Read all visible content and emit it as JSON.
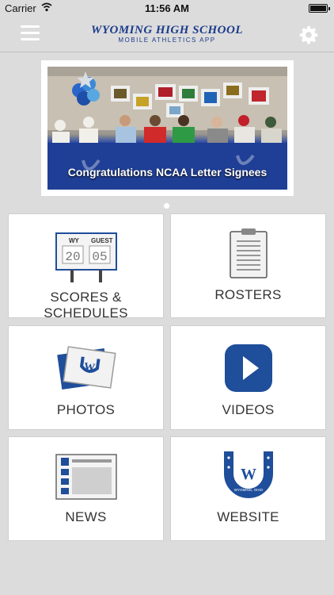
{
  "status_bar": {
    "carrier": "Carrier",
    "time": "11:56 AM"
  },
  "header": {
    "title": "WYOMING HIGH SCHOOL",
    "subtitle": "MOBILE ATHLETICS APP"
  },
  "banner": {
    "caption": "Congratulations NCAA Letter Signees",
    "page_count": 1,
    "current_page": 1
  },
  "scoreboard": {
    "home": "WY",
    "away": "GUEST",
    "home_score": "20",
    "away_score": "05"
  },
  "tiles": [
    {
      "label": "SCORES & SCHEDULES",
      "icon": "scoreboard-icon"
    },
    {
      "label": "ROSTERS",
      "icon": "clipboard-icon"
    },
    {
      "label": "PHOTOS",
      "icon": "photos-icon"
    },
    {
      "label": "VIDEOS",
      "icon": "play-icon"
    },
    {
      "label": "NEWS",
      "icon": "newspaper-icon"
    },
    {
      "label": "WEBSITE",
      "icon": "horseshoe-logo-icon"
    }
  ],
  "logo": {
    "letter": "W",
    "ring_text": "WYOMING, OHIO"
  },
  "colors": {
    "brand_blue": "#1a3a8a",
    "icon_blue": "#1f4e9a",
    "background": "#dcdcdc"
  }
}
